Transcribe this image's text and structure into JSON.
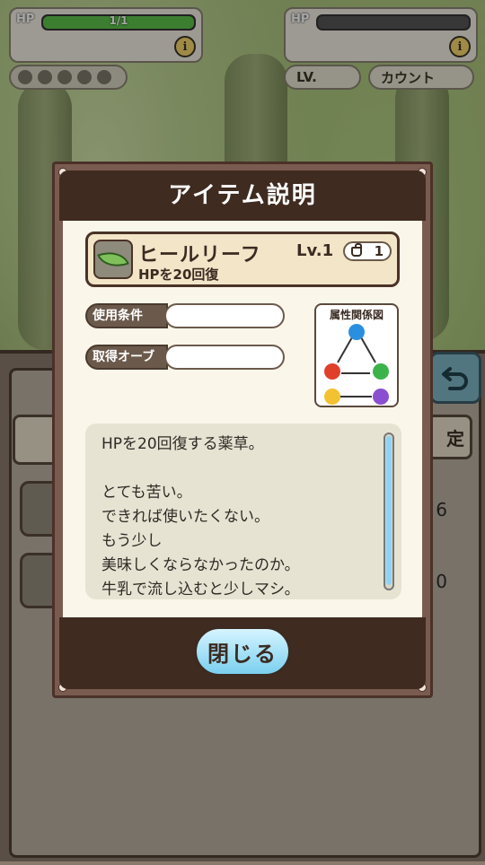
{
  "top": {
    "player_hp_label": "HP",
    "player_hp_value": "1/1",
    "player_hp_fraction": 1.0,
    "enemy_hp_label": "HP",
    "enemy_hp_fraction": 0.0,
    "info_glyph": "i",
    "orbs_count": 5,
    "lv_label": "LV.",
    "count_label": "カウント"
  },
  "background": {
    "left_tab_text": "",
    "right_tab_text": "定",
    "row_values": [
      "6",
      "0"
    ],
    "back_icon": "undo-arrow-icon"
  },
  "modal": {
    "title": "アイテム説明",
    "item": {
      "icon": "leaf-icon",
      "name": "ヒールリーフ",
      "subtitle": "HPを20回復",
      "level": "Lv.1",
      "quantity": "1"
    },
    "fields": [
      {
        "label": "使用条件",
        "value": ""
      },
      {
        "label": "取得オーブ",
        "value": ""
      }
    ],
    "attribute_chart": {
      "title": "属性関係図",
      "colors": {
        "water": "#2a8fe0",
        "fire": "#e0402a",
        "wind": "#3cb34a",
        "light": "#f2c230",
        "dark": "#8a4fd0"
      }
    },
    "description_lines": [
      "HPを20回復する薬草。",
      "",
      "とても苦い。",
      "できれば使いたくない。",
      "もう少し",
      "美味しくならなかったのか。",
      "牛乳で流し込むと少しマシ。"
    ],
    "close_label": "閉じる"
  }
}
